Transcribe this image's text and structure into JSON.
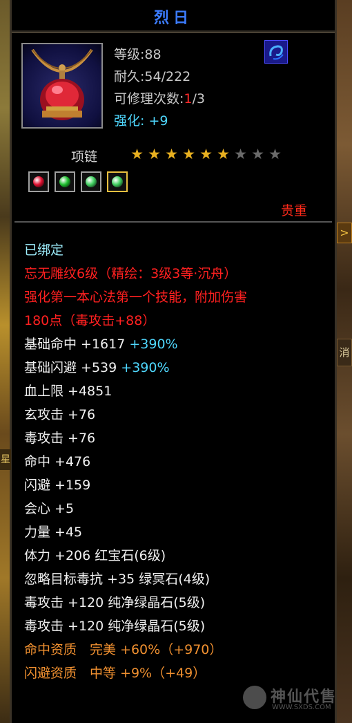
{
  "item": {
    "name": "烈日",
    "level_label": "等级:88",
    "durability_label": "耐久:54/222",
    "repair_prefix": "可修理次数:",
    "repair_used": "1",
    "repair_total": "/3",
    "enhance_label": "强化: ",
    "enhance_value": "+9",
    "type": "项链",
    "stars_filled": 6,
    "stars_total": 9,
    "precious_label": "贵重"
  },
  "gems": [
    {
      "icon": "red-gem-icon",
      "color": "#e01030"
    },
    {
      "icon": "green-gem-icon",
      "color": "#20c030"
    },
    {
      "icon": "green-crystal-icon",
      "color": "#40d060"
    },
    {
      "icon": "green-crystal-gold-icon",
      "color": "#40d060"
    }
  ],
  "stats": {
    "bound": "已绑定",
    "engrave_1": "忘无雕纹6级（精绘：3级3等·沉舟）",
    "engrave_2": "强化第一本心法第一个技能，附加伤害",
    "engrave_3": "180点（毒攻击+88）",
    "base_hit": "基础命中 +1617",
    "base_hit_pct": "+390%",
    "base_dodge": "基础闪避 +539",
    "base_dodge_pct": "+390%",
    "hp": "血上限 +4851",
    "xuan_atk": "玄攻击 +76",
    "poison_atk": "毒攻击 +76",
    "hit": "命中 +476",
    "dodge": "闪避 +159",
    "crit": "会心 +5",
    "strength": "力量 +45",
    "stamina": "体力 +206 ",
    "stamina_gem": "红宝石(6级)",
    "ignore_poison": "忽略目标毒抗 +35 ",
    "ignore_poison_gem": "绿冥石(4级)",
    "poison_atk_gem1": "毒攻击 +120 ",
    "poison_atk_gem1_name": "纯净绿晶石(5级)",
    "poison_atk_gem2": "毒攻击 +120 ",
    "poison_atk_gem2_name": "纯净绿晶石(5级)",
    "hit_quality": "命中资质　完美 +60%（+970）",
    "dodge_quality": "闪避资质　中等 +9%（+49）"
  },
  "side_tabs": {
    "right_tab_1": ">",
    "right_tab_2": "消",
    "left_tab": "星"
  },
  "watermark": {
    "text": "神仙代售",
    "url": "WWW.SXDS.COM"
  },
  "colors": {
    "title": "#3c7cff",
    "enhance": "#4fd8ff",
    "precious": "#ff2a1a",
    "engrave": "#ff2020",
    "quality": "#f09030",
    "star_on": "#e8b020",
    "star_off": "#6a6a6a"
  }
}
